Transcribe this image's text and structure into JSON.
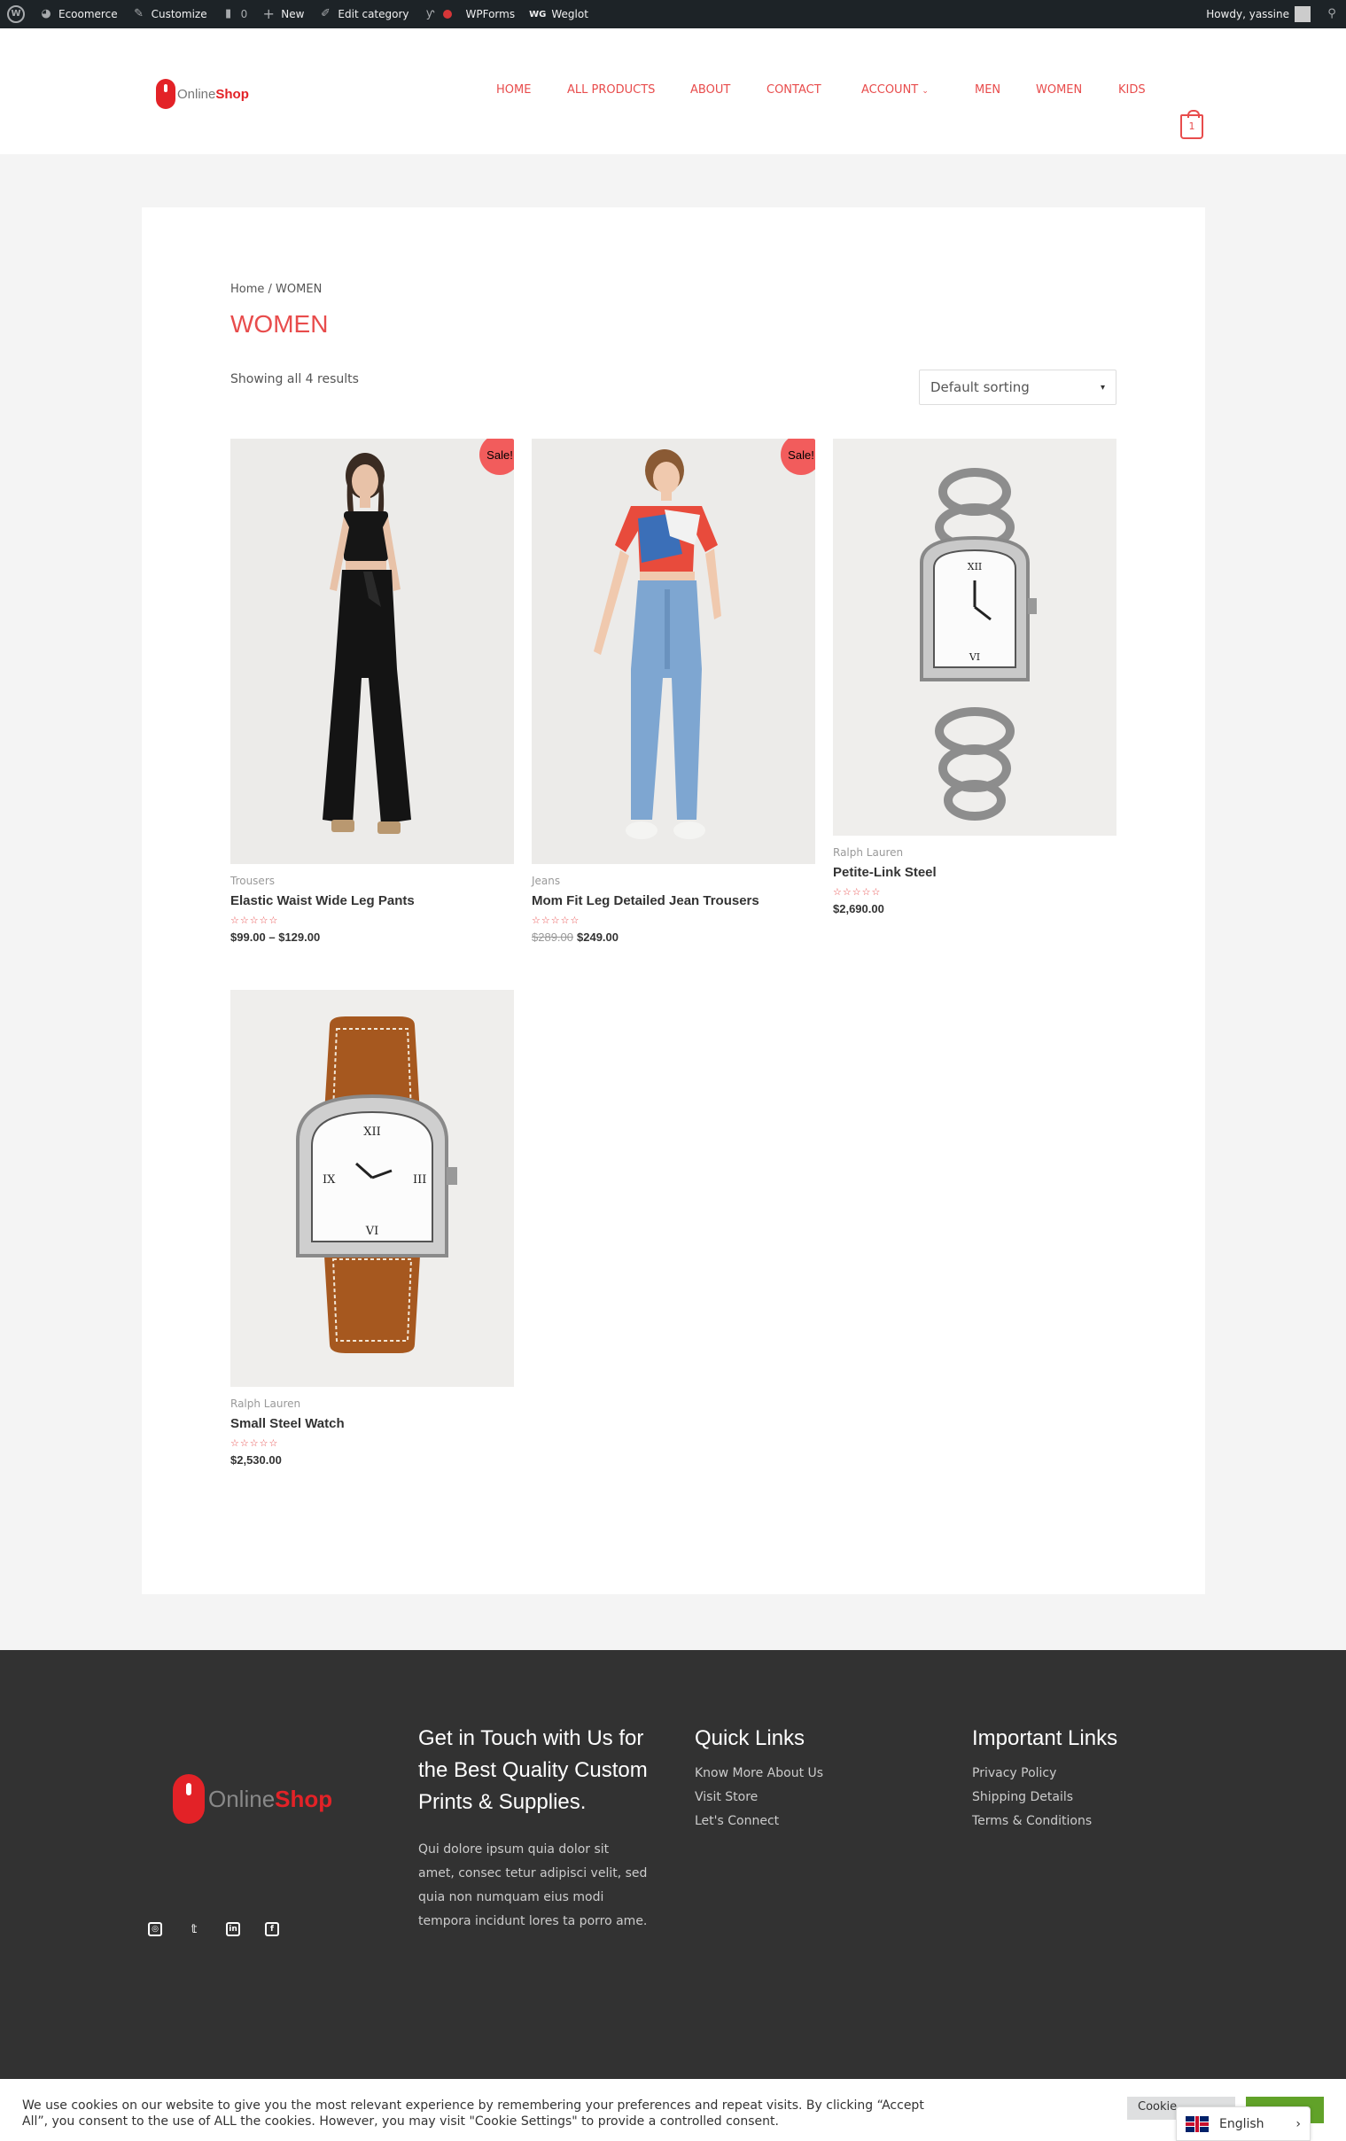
{
  "adminbar": {
    "site_name": "Ecoomerce",
    "customize": "Customize",
    "comments_count": "0",
    "new_label": "New",
    "edit_category": "Edit category",
    "wpforms": "WPForms",
    "weglot": "Weglot",
    "weglot_badge": "WG",
    "howdy": "Howdy, yassine"
  },
  "header": {
    "logo_online": "Online",
    "logo_shop": "Shop",
    "nav": [
      "HOME",
      "ALL PRODUCTS",
      "ABOUT",
      "CONTACT",
      "ACCOUNT",
      "MEN",
      "WOMEN",
      "KIDS"
    ],
    "cart_count": "1",
    "accent_color": "#e84c4c"
  },
  "shop": {
    "breadcrumb_home": "Home",
    "breadcrumb_sep": " / ",
    "breadcrumb_current": "WOMEN",
    "title": "WOMEN",
    "result_count": "Showing all 4 results",
    "sorting": "Default sorting",
    "sale_label": "Sale!",
    "products": [
      {
        "category": "Trousers",
        "name": "Elastic Waist Wide Leg Pants",
        "rating": 0,
        "price": "$99.00 – $129.00",
        "old_price": ""
      },
      {
        "category": "Jeans",
        "name": "Mom Fit Leg Detailed Jean Trousers",
        "rating": 0,
        "price": "$249.00",
        "old_price": "$289.00"
      },
      {
        "category": "Ralph Lauren",
        "name": "Petite-Link Steel",
        "rating": 0,
        "price": "$2,690.00",
        "old_price": ""
      },
      {
        "category": "Ralph Lauren",
        "name": "Small Steel Watch",
        "rating": 0,
        "price": "$2,530.00",
        "old_price": ""
      }
    ]
  },
  "footer": {
    "logo_online": "Online",
    "logo_shop": "Shop",
    "col1_heading": "Get in Touch with Us for the Best Quality Custom Prints & Supplies.",
    "col1_text": "Qui dolore ipsum quia dolor sit amet, consec tetur adipisci velit, sed quia non numquam eius modi tempora incidunt lores ta porro ame.",
    "quick_heading": "Quick Links",
    "quick_links": [
      "Know More About Us",
      "Visit Store",
      "Let's Connect"
    ],
    "important_heading": "Important Links",
    "important_links": [
      "Privacy Policy",
      "Shipping Details",
      "Terms & Conditions"
    ],
    "social_icons": [
      "instagram-icon",
      "twitter-icon",
      "linkedin-icon",
      "facebook-icon"
    ]
  },
  "cookie": {
    "text": "We use cookies on our website to give you the most relevant experience by remembering your preferences and repeat visits. By clicking “Accept All”, you consent to the use of ALL the cookies. However, you may visit \"Cookie Settings\" to provide a controlled consent.",
    "settings_label": "Cookie",
    "accept_label": ""
  },
  "language": {
    "current": "English"
  }
}
